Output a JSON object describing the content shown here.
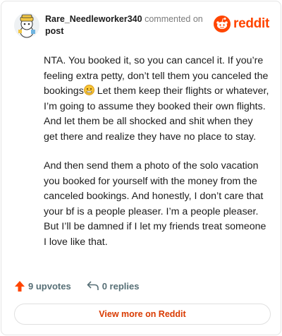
{
  "header": {
    "username": "Rare_Needleworker340",
    "action_text": "commented on",
    "post_link": "post",
    "logo_text": "reddit",
    "avatar_icon": "snoo-avatar-icon",
    "logo_icon": "reddit-snoo-icon"
  },
  "comment": {
    "paragraphs": [
      {
        "before_emoji": "NTA. You booked it, so you can cancel it. If you’re feeling extra petty, don’t tell them you canceled the bookings",
        "after_emoji": " Let them keep their flights or whatever, I’m going to assume they booked their own flights. And let them be all shocked and shit when they get there and realize they have no place to stay."
      },
      {
        "text": "And then send them a photo of the solo vacation you booked for yourself with the money from the canceled bookings. And honestly, I don’t care that your bf is a people pleaser. I’m a people pleaser. But I’ll be damned if I let my friends treat someone I love like that."
      }
    ]
  },
  "actions": {
    "upvotes": "9 upvotes",
    "replies": "0 replies",
    "upvote_icon": "upvote-arrow-icon",
    "reply_icon": "reply-arrow-icon"
  },
  "footer": {
    "view_more_label": "View more on Reddit"
  },
  "colors": {
    "brand": "#ff4500",
    "upvote": "#ff4500",
    "link": "#d93a00"
  }
}
